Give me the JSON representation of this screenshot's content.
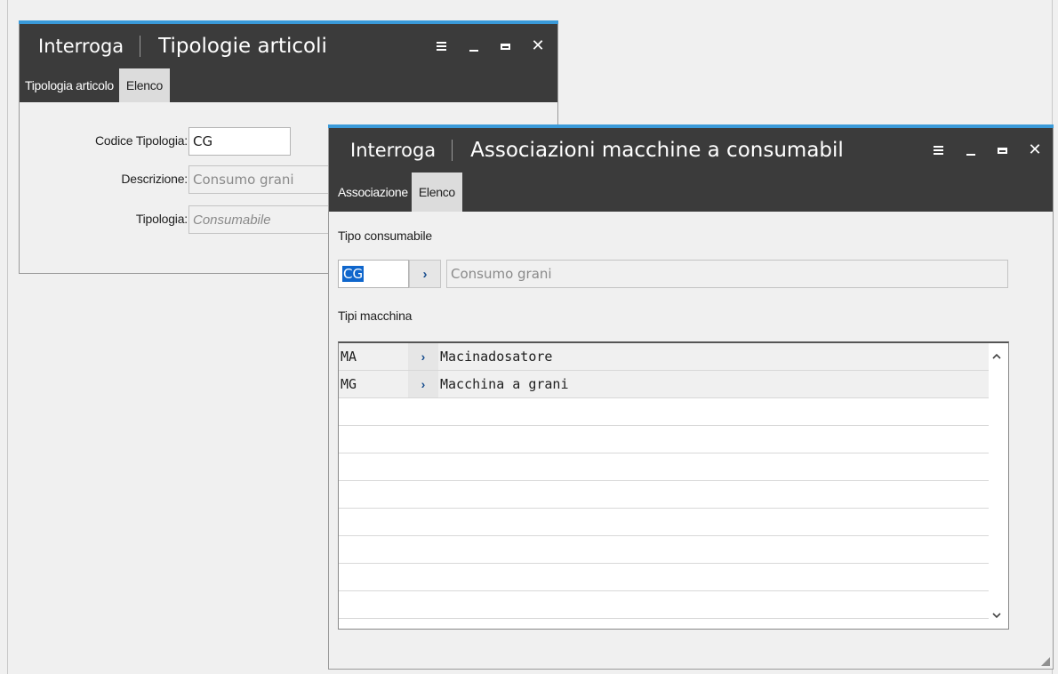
{
  "window_back": {
    "mode": "Interroga",
    "title": "Tipologie articoli",
    "tabs": [
      {
        "label": "Tipologia articolo"
      },
      {
        "label": "Elenco"
      }
    ],
    "fields": {
      "codice_label": "Codice Tipologia:",
      "codice_value": "CG",
      "descrizione_label": "Descrizione:",
      "descrizione_value": "Consumo grani",
      "tipologia_label": "Tipologia:",
      "tipologia_value": "Consumabile"
    }
  },
  "window_front": {
    "mode": "Interroga",
    "title": "Associazioni macchine a consumabil",
    "tabs": [
      {
        "label": "Associazione"
      },
      {
        "label": "Elenco"
      }
    ],
    "tipo_consumabile_label": "Tipo consumabile",
    "tipo_code": "CG",
    "tipo_desc": "Consumo grani",
    "tipi_macchina_label": "Tipi macchina",
    "rows": [
      {
        "code": "MA",
        "desc": "Macinadosatore"
      },
      {
        "code": "MG",
        "desc": "Macchina a grani"
      }
    ]
  },
  "icons": {
    "menu": "hamburger-icon",
    "minimize": "minimize-icon",
    "maximize": "maximize-icon",
    "close": "close-icon",
    "zoom": "chevron-right-icon"
  },
  "colors": {
    "titlebar": "#3b3b3b",
    "accent": "#3a9ad9",
    "selection": "#0f66cc"
  }
}
